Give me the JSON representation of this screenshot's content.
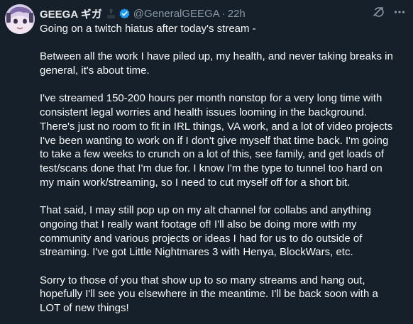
{
  "tweet": {
    "display_name": "GEEGA ギガ",
    "handle": "@GeneralGEEGA",
    "separator": "·",
    "time": "22h",
    "paragraphs": [
      "Going on a twitch hiatus after today's stream -",
      "Between all the work I have piled up, my health, and never taking breaks in\ngeneral, it's about time.",
      "I've streamed 150-200 hours per month nonstop for a very long time with\nconsistent legal worries and health issues looming in the background.\nThere's just no room to fit in IRL things, VA work, and a lot of video projects\nI've been wanting to work on if I don't give myself that time back.  I'm going\nto take a few weeks  to crunch on a lot of this, see family, and get loads of\ntest/scans done that I'm due for.  I know I'm the type to tunnel too hard on\nmy main work/streaming, so I need to cut myself off for a short bit.",
      "That said, I may still pop up on my alt channel for collabs and anything\nongoing that I really want footage of!  I'll also be doing more with my\ncommunity and various projects or ideas I had for us to do outside of\nstreaming.  I've got Little Nightmares 3 with Henya, BlockWars, etc.",
      "Sorry to those of you that show up to so many streams and hang out,\nhopefully I'll see you elsewhere in the meantime. I'll be back soon with a\nLOT of new things!"
    ]
  },
  "icons": {
    "avatar": "avatar-image",
    "affiliate": "affiliate-badge-icon",
    "verified": "verified-badge-icon",
    "grok": "grok-icon",
    "more": "more-options-icon"
  },
  "colors": {
    "background": "#15202b",
    "text": "#f7f9f9",
    "secondary": "#8b98a5",
    "verified": "#1d9bf0"
  }
}
